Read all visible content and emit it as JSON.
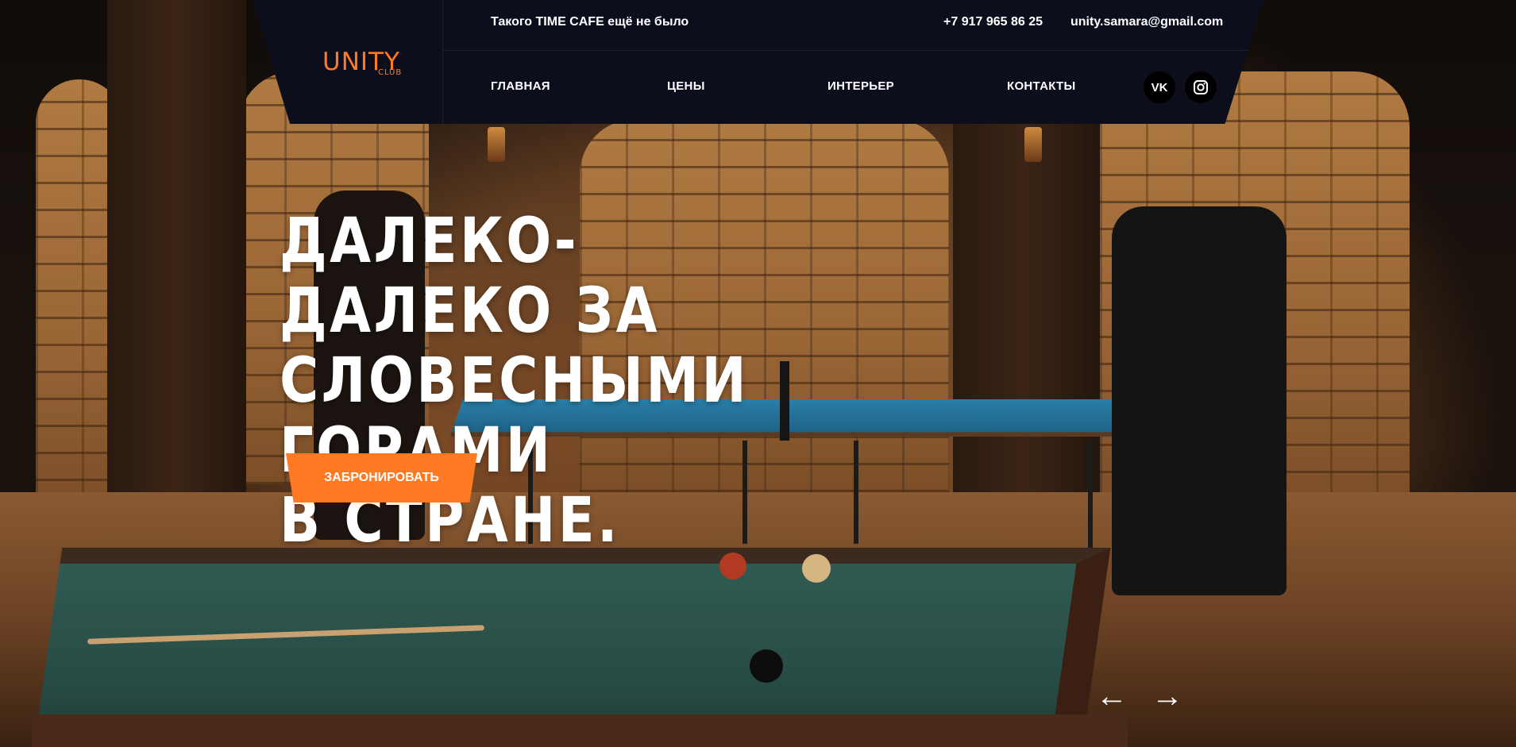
{
  "header": {
    "logo": {
      "text": "UNITY",
      "sub": "CLUB"
    },
    "tagline": "Такого TIME CAFE ещё не было",
    "phone": "+7 917 965 86 25",
    "email": "unity.samara@gmail.com",
    "nav": [
      {
        "label": "ГЛАВНАЯ"
      },
      {
        "label": "ЦЕНЫ"
      },
      {
        "label": "ИНТЕРЬЕР"
      },
      {
        "label": "КОНТАКТЫ"
      }
    ],
    "social": [
      {
        "icon": "vk-icon",
        "glyph": "VK"
      },
      {
        "icon": "instagram-icon",
        "glyph": "◎"
      }
    ]
  },
  "hero": {
    "title_lines": [
      "ДАЛЕКО-ДАЛЕКО ЗА",
      "СЛОВЕСНЫМИ ГОРАМИ",
      "В СТРАНЕ."
    ],
    "cta_label": "ЗАБРОНИРОВАТЬ",
    "prev_glyph": "←",
    "next_glyph": "→"
  },
  "colors": {
    "accent": "#ff7a22",
    "header_bg": "#0c0e1c",
    "text": "#ffffff"
  }
}
